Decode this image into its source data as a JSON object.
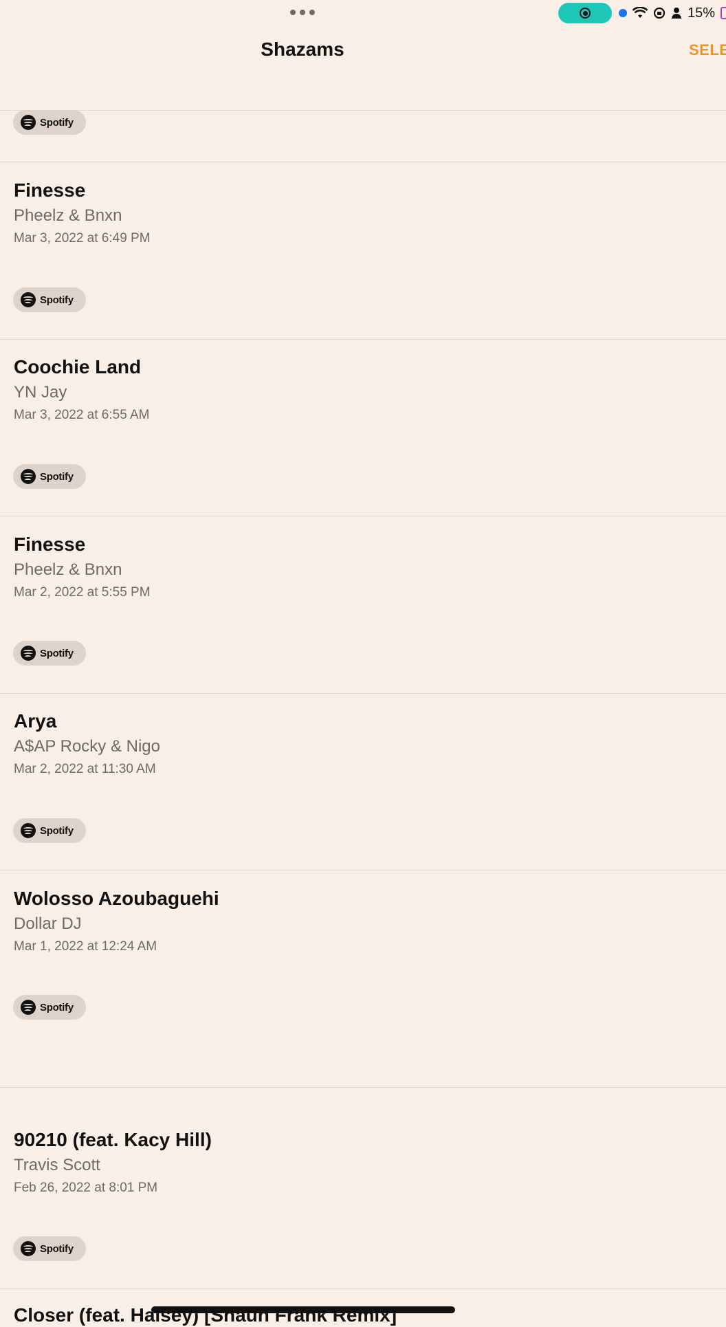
{
  "status_bar": {
    "battery_percent": "15%",
    "icons": [
      "more-dots-icon",
      "screen-record-icon",
      "location-dot-icon",
      "wifi-icon",
      "orientation-lock-icon",
      "person-icon",
      "battery-icon"
    ]
  },
  "nav": {
    "title": "Shazams",
    "select_label": "SELE"
  },
  "spotify_label": "Spotify",
  "entries": [
    {
      "title": "Finesse",
      "artist": "Pheelz & Bnxn",
      "date": "Mar 3, 2022 at 6:49 PM"
    },
    {
      "title": "Coochie Land",
      "artist": "YN Jay",
      "date": "Mar 3, 2022 at 6:55 AM"
    },
    {
      "title": "Finesse",
      "artist": "Pheelz & Bnxn",
      "date": "Mar 2, 2022 at 5:55 PM"
    },
    {
      "title": "Arya",
      "artist": "A$AP Rocky & Nigo",
      "date": "Mar 2, 2022 at 11:30 AM"
    },
    {
      "title": "Wolosso Azoubaguehi",
      "artist": "Dollar DJ",
      "date": "Mar 1, 2022 at 12:24 AM"
    },
    {
      "title": "90210 (feat. Kacy Hill)",
      "artist": "Travis Scott",
      "date": "Feb 26, 2022 at 8:01 PM"
    }
  ],
  "partial_entry_title": "Closer (feat. Halsey) [Shaun Frank Remix]"
}
